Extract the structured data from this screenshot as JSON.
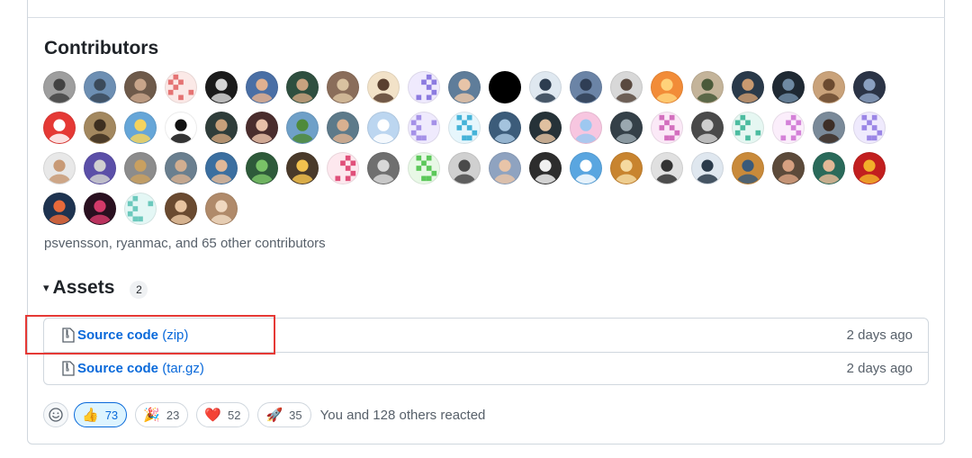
{
  "contributors": {
    "title": "Contributors",
    "summary": "psvensson, ryanmac, and 65 other contributors",
    "avatars": [
      {
        "bg": "#9e9e9e",
        "kind": "photo",
        "fg": "#424242"
      },
      {
        "bg": "#6d8fb3",
        "kind": "photo",
        "fg": "#3b4a5a"
      },
      {
        "bg": "#6e5a4a",
        "kind": "photo",
        "fg": "#c8a58a"
      },
      {
        "bg": "#fbe9e7",
        "kind": "identicon",
        "fg": "#e57373"
      },
      {
        "bg": "#1b1b1b",
        "kind": "photo",
        "fg": "#d6d6d6"
      },
      {
        "bg": "#4a6fa5",
        "kind": "photo",
        "fg": "#e0b090"
      },
      {
        "bg": "#2f4f3f",
        "kind": "photo",
        "fg": "#c9a27f"
      },
      {
        "bg": "#8a6d5a",
        "kind": "photo",
        "fg": "#d9c2a0"
      },
      {
        "bg": "#f2e2c8",
        "kind": "photo",
        "fg": "#5a4030"
      },
      {
        "bg": "#efeafd",
        "kind": "identicon",
        "fg": "#8c7be0"
      },
      {
        "bg": "#5f7d9a",
        "kind": "photo",
        "fg": "#e7c4a8"
      },
      {
        "bg": "#000000",
        "kind": "photo",
        "fg": "#000000"
      },
      {
        "bg": "#dfe8f0",
        "kind": "photo",
        "fg": "#2d3d50"
      },
      {
        "bg": "#6b84a6",
        "kind": "photo",
        "fg": "#2f3e55"
      },
      {
        "bg": "#d8d8d8",
        "kind": "photo",
        "fg": "#5a4a40"
      },
      {
        "bg": "#f28c38",
        "kind": "photo",
        "fg": "#ffd27a"
      },
      {
        "bg": "#c4b49a",
        "kind": "photo",
        "fg": "#4a5a3a"
      },
      {
        "bg": "#2a3a4a",
        "kind": "photo",
        "fg": "#c99a70"
      },
      {
        "bg": "#1f2933",
        "kind": "photo",
        "fg": "#6f8aa3"
      },
      {
        "bg": "#c9a27a",
        "kind": "photo",
        "fg": "#6b4a30"
      },
      {
        "bg": "#2b3446",
        "kind": "photo",
        "fg": "#8aa0c0"
      },
      {
        "bg": "#e53935",
        "kind": "photo",
        "fg": "#ffffff"
      },
      {
        "bg": "#a3885f",
        "kind": "photo",
        "fg": "#3d2f20"
      },
      {
        "bg": "#66a6d8",
        "kind": "photo",
        "fg": "#f4d35e"
      },
      {
        "bg": "#ffffff",
        "kind": "photo",
        "fg": "#111111"
      },
      {
        "bg": "#2f3d3a",
        "kind": "photo",
        "fg": "#c9a07a"
      },
      {
        "bg": "#4a2d2d",
        "kind": "photo",
        "fg": "#e8c0a8"
      },
      {
        "bg": "#6fa0c8",
        "kind": "photo",
        "fg": "#4f8a3a"
      },
      {
        "bg": "#5d7a8a",
        "kind": "photo",
        "fg": "#d9b090"
      },
      {
        "bg": "#bcd6f0",
        "kind": "photo",
        "fg": "#ffffff"
      },
      {
        "bg": "#efeafd",
        "kind": "identicon",
        "fg": "#a591e8"
      },
      {
        "bg": "#e6f6fc",
        "kind": "identicon",
        "fg": "#45b3d8"
      },
      {
        "bg": "#3c5c7a",
        "kind": "photo",
        "fg": "#a4c3de"
      },
      {
        "bg": "#263238",
        "kind": "photo",
        "fg": "#e0c0a0"
      },
      {
        "bg": "#f7c6e0",
        "kind": "photo",
        "fg": "#9ec8f0"
      },
      {
        "bg": "#344048",
        "kind": "photo",
        "fg": "#9aa8b0"
      },
      {
        "bg": "#fbe9f7",
        "kind": "identicon",
        "fg": "#d36fbe"
      },
      {
        "bg": "#4a4a4a",
        "kind": "photo",
        "fg": "#cfcfcf"
      },
      {
        "bg": "#e6f7f2",
        "kind": "identicon",
        "fg": "#4cbca0"
      },
      {
        "bg": "#fbeefb",
        "kind": "identicon",
        "fg": "#d481d8"
      },
      {
        "bg": "#7a8a99",
        "kind": "photo",
        "fg": "#3d2e26"
      },
      {
        "bg": "#efeafd",
        "kind": "identicon",
        "fg": "#9b86e6"
      },
      {
        "bg": "#e8e8e8",
        "kind": "photo",
        "fg": "#c89a76"
      },
      {
        "bg": "#5b4fa8",
        "kind": "photo",
        "fg": "#d0d0d0"
      },
      {
        "bg": "#8c8c8c",
        "kind": "photo",
        "fg": "#c9a060"
      },
      {
        "bg": "#6a7f8f",
        "kind": "photo",
        "fg": "#d2ae90"
      },
      {
        "bg": "#3b6fa0",
        "kind": "photo",
        "fg": "#e0b898"
      },
      {
        "bg": "#2e5a3a",
        "kind": "photo",
        "fg": "#79c267"
      },
      {
        "bg": "#4a3a2a",
        "kind": "photo",
        "fg": "#f2c14e"
      },
      {
        "bg": "#fde8ee",
        "kind": "identicon",
        "fg": "#e0507a"
      },
      {
        "bg": "#6f6f6f",
        "kind": "photo",
        "fg": "#d8d8d8"
      },
      {
        "bg": "#e8f8e6",
        "kind": "identicon",
        "fg": "#5cc85a"
      },
      {
        "bg": "#d0d0d0",
        "kind": "photo",
        "fg": "#4a4a4a"
      },
      {
        "bg": "#8fa3c0",
        "kind": "photo",
        "fg": "#e8c4a8"
      },
      {
        "bg": "#2d2d2d",
        "kind": "photo",
        "fg": "#f0f0f0"
      },
      {
        "bg": "#5aa6e0",
        "kind": "photo",
        "fg": "#ffffff"
      },
      {
        "bg": "#c8842f",
        "kind": "photo",
        "fg": "#f5d9a0"
      },
      {
        "bg": "#e0e0e0",
        "kind": "photo",
        "fg": "#333333"
      },
      {
        "bg": "#dfe7ef",
        "kind": "photo",
        "fg": "#2a3a4a"
      },
      {
        "bg": "#c98a3a",
        "kind": "photo",
        "fg": "#3a5a7a"
      },
      {
        "bg": "#5c4a3a",
        "kind": "photo",
        "fg": "#d6a080"
      },
      {
        "bg": "#2a6a5a",
        "kind": "photo",
        "fg": "#e2b896"
      },
      {
        "bg": "#c21f1f",
        "kind": "photo",
        "fg": "#f2b02a"
      },
      {
        "bg": "#1e3350",
        "kind": "photo",
        "fg": "#e86a3a"
      },
      {
        "bg": "#2a1020",
        "kind": "photo",
        "fg": "#d43a6a"
      },
      {
        "bg": "#e4f7f5",
        "kind": "identicon",
        "fg": "#6cc9bd"
      },
      {
        "bg": "#6a4a30",
        "kind": "photo",
        "fg": "#e8c4a0"
      },
      {
        "bg": "#b08a6a",
        "kind": "photo",
        "fg": "#f0d8c0"
      }
    ]
  },
  "assets": {
    "toggle": "▾",
    "title": "Assets",
    "count": "2",
    "items": [
      {
        "name": "Source code",
        "ext": "(zip)",
        "date": "2 days ago"
      },
      {
        "name": "Source code",
        "ext": "(tar.gz)",
        "date": "2 days ago"
      }
    ]
  },
  "reactions": {
    "add_icon": "smiley-icon",
    "items": [
      {
        "emoji": "👍",
        "count": "73",
        "active": true
      },
      {
        "emoji": "🎉",
        "count": "23",
        "active": false
      },
      {
        "emoji": "❤️",
        "count": "52",
        "active": false
      },
      {
        "emoji": "🚀",
        "count": "35",
        "active": false
      }
    ],
    "summary": "You and 128 others reacted"
  },
  "colors": {
    "link": "#0969da",
    "muted": "#57606a",
    "highlight_box": "#e53935"
  }
}
